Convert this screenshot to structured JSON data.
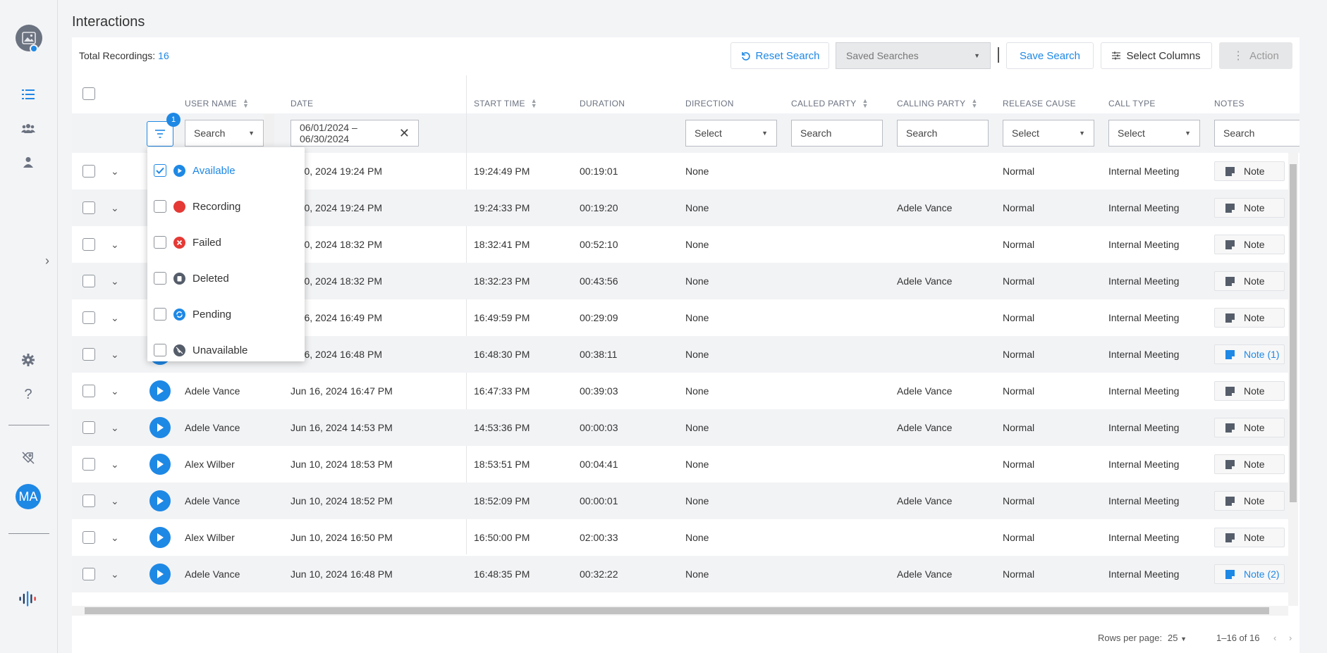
{
  "page": {
    "title": "Interactions"
  },
  "sidebar": {
    "avatar_initials": "MA"
  },
  "toolbar": {
    "total_label": "Total Recordings:",
    "total_count": "16",
    "reset_label": "Reset Search",
    "saved_placeholder": "Saved Searches",
    "save_label": "Save Search",
    "columns_label": "Select Columns",
    "action_label": "Action"
  },
  "columns": {
    "user_name": "USER NAME",
    "date": "DATE",
    "start_time": "START TIME",
    "duration": "DURATION",
    "direction": "DIRECTION",
    "called_party": "CALLED PARTY",
    "calling_party": "CALLING PARTY",
    "release_cause": "RELEASE CAUSE",
    "call_type": "CALL TYPE",
    "notes": "NOTES"
  },
  "filters": {
    "status_count": "1",
    "user_search": "Search",
    "date_range": "06/01/2024 – 06/30/2024",
    "direction": "Select",
    "called_party": "Search",
    "calling_party": "Search",
    "release_cause": "Select",
    "call_type": "Select",
    "notes": "Search"
  },
  "status_options": [
    {
      "label": "Available",
      "checked": true,
      "color": "#1e88e5",
      "icon": "play-icon"
    },
    {
      "label": "Recording",
      "checked": false,
      "color": "#e53935",
      "icon": "recording-dot-icon"
    },
    {
      "label": "Failed",
      "checked": false,
      "color": "#e53935",
      "icon": "failed-x-icon"
    },
    {
      "label": "Deleted",
      "checked": false,
      "color": "#555d6a",
      "icon": "trash-icon"
    },
    {
      "label": "Pending",
      "checked": false,
      "color": "#1e88e5",
      "icon": "sync-icon"
    },
    {
      "label": "Unavailable",
      "checked": false,
      "color": "#555d6a",
      "icon": "phone-off-icon"
    }
  ],
  "rows": [
    {
      "user": "",
      "date": "n 20, 2024 19:24 PM",
      "start": "19:24:49 PM",
      "duration": "00:19:01",
      "direction": "None",
      "called": "",
      "calling": "",
      "release": "Normal",
      "type": "Internal Meeting",
      "note": "Note"
    },
    {
      "user": "",
      "date": "n 20, 2024 19:24 PM",
      "start": "19:24:33 PM",
      "duration": "00:19:20",
      "direction": "None",
      "called": "",
      "calling": "Adele Vance",
      "release": "Normal",
      "type": "Internal Meeting",
      "note": "Note"
    },
    {
      "user": "",
      "date": "n 20, 2024 18:32 PM",
      "start": "18:32:41 PM",
      "duration": "00:52:10",
      "direction": "None",
      "called": "",
      "calling": "",
      "release": "Normal",
      "type": "Internal Meeting",
      "note": "Note"
    },
    {
      "user": "",
      "date": "n 20, 2024 18:32 PM",
      "start": "18:32:23 PM",
      "duration": "00:43:56",
      "direction": "None",
      "called": "",
      "calling": "Adele Vance",
      "release": "Normal",
      "type": "Internal Meeting",
      "note": "Note"
    },
    {
      "user": "",
      "date": "n 16, 2024 16:49 PM",
      "start": "16:49:59 PM",
      "duration": "00:29:09",
      "direction": "None",
      "called": "",
      "calling": "",
      "release": "Normal",
      "type": "Internal Meeting",
      "note": "Note"
    },
    {
      "user": "",
      "date": "n 16, 2024 16:48 PM",
      "start": "16:48:30 PM",
      "duration": "00:38:11",
      "direction": "None",
      "called": "",
      "calling": "",
      "release": "Normal",
      "type": "Internal Meeting",
      "note": "Note (1)"
    },
    {
      "user": "Adele Vance",
      "date": "Jun 16, 2024 16:47 PM",
      "start": "16:47:33 PM",
      "duration": "00:39:03",
      "direction": "None",
      "called": "",
      "calling": "Adele Vance",
      "release": "Normal",
      "type": "Internal Meeting",
      "note": "Note"
    },
    {
      "user": "Adele Vance",
      "date": "Jun 16, 2024 14:53 PM",
      "start": "14:53:36 PM",
      "duration": "00:00:03",
      "direction": "None",
      "called": "",
      "calling": "Adele Vance",
      "release": "Normal",
      "type": "Internal Meeting",
      "note": "Note"
    },
    {
      "user": "Alex Wilber",
      "date": "Jun 10, 2024 18:53 PM",
      "start": "18:53:51 PM",
      "duration": "00:04:41",
      "direction": "None",
      "called": "",
      "calling": "",
      "release": "Normal",
      "type": "Internal Meeting",
      "note": "Note"
    },
    {
      "user": "Adele Vance",
      "date": "Jun 10, 2024 18:52 PM",
      "start": "18:52:09 PM",
      "duration": "00:00:01",
      "direction": "None",
      "called": "",
      "calling": "Adele Vance",
      "release": "Normal",
      "type": "Internal Meeting",
      "note": "Note"
    },
    {
      "user": "Alex Wilber",
      "date": "Jun 10, 2024 16:50 PM",
      "start": "16:50:00 PM",
      "duration": "02:00:33",
      "direction": "None",
      "called": "",
      "calling": "",
      "release": "Normal",
      "type": "Internal Meeting",
      "note": "Note"
    },
    {
      "user": "Adele Vance",
      "date": "Jun 10, 2024 16:48 PM",
      "start": "16:48:35 PM",
      "duration": "00:32:22",
      "direction": "None",
      "called": "",
      "calling": "Adele Vance",
      "release": "Normal",
      "type": "Internal Meeting",
      "note": "Note (2)"
    }
  ],
  "pagination": {
    "rows_label": "Rows per page:",
    "rows_value": "25",
    "range": "1–16 of 16"
  },
  "colors": {
    "accent": "#1e88e5"
  }
}
